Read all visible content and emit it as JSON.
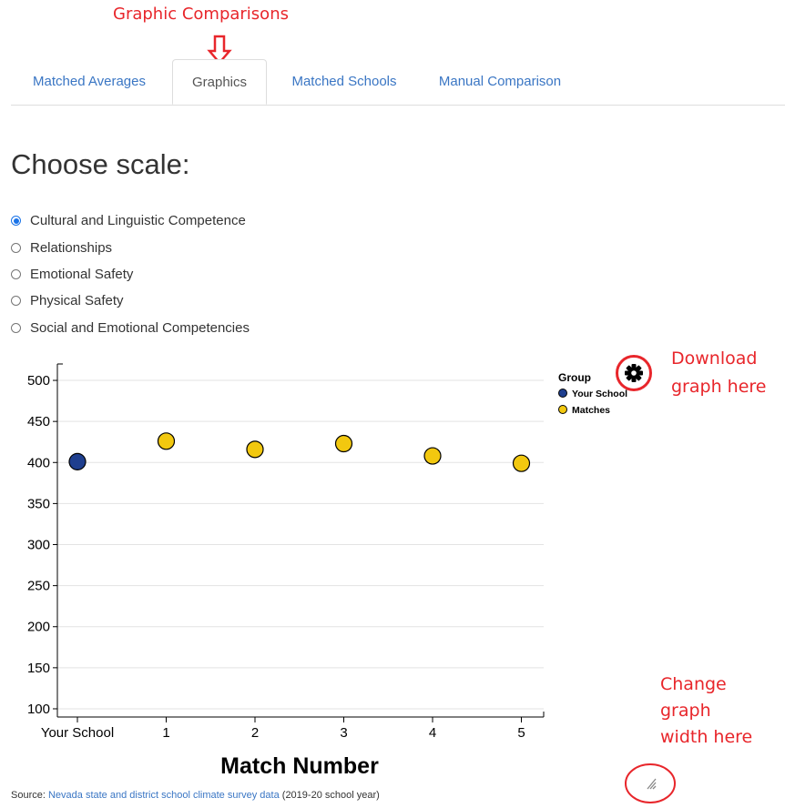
{
  "annotations": {
    "top": "Graphic Comparisons",
    "download": [
      "Download",
      "graph here"
    ],
    "width": [
      "Change",
      "graph",
      "width here"
    ]
  },
  "tabs": [
    {
      "label": "Matched Averages",
      "active": false
    },
    {
      "label": "Graphics",
      "active": true
    },
    {
      "label": "Matched Schools",
      "active": false
    },
    {
      "label": "Manual Comparison",
      "active": false
    }
  ],
  "scale_heading": "Choose scale:",
  "scales": [
    {
      "label": "Cultural and Linguistic Competence",
      "selected": true
    },
    {
      "label": "Relationships",
      "selected": false
    },
    {
      "label": "Emotional Safety",
      "selected": false
    },
    {
      "label": "Physical Safety",
      "selected": false
    },
    {
      "label": "Social and Emotional Competencies",
      "selected": false
    }
  ],
  "chart_data": {
    "type": "scatter",
    "xlabel": "Match Number",
    "ylabel": "",
    "categories": [
      "Your School",
      "1",
      "2",
      "3",
      "4",
      "5"
    ],
    "y_ticks": [
      100,
      150,
      200,
      250,
      300,
      350,
      400,
      450,
      500
    ],
    "ylim": [
      90,
      520
    ],
    "grid": true,
    "legend_title": "Group",
    "legend_position": "right",
    "series": [
      {
        "name": "Your School",
        "color": "#1f3f8f",
        "points": [
          {
            "x": "Your School",
            "y": 401
          }
        ]
      },
      {
        "name": "Matches",
        "color": "#f2c80f",
        "points": [
          {
            "x": "1",
            "y": 426
          },
          {
            "x": "2",
            "y": 416
          },
          {
            "x": "3",
            "y": 423
          },
          {
            "x": "4",
            "y": 408
          },
          {
            "x": "5",
            "y": 399
          }
        ]
      }
    ]
  },
  "icons": {
    "gear": "gear-icon",
    "resize": "resize-handle-icon",
    "arrow": "arrow-down-icon"
  },
  "colors": {
    "annotation": "#e8262b",
    "link": "#3a76c4",
    "radio_checked": "#1a73e8"
  },
  "source": {
    "prefix": "Source: ",
    "link_text": "Nevada state and district school climate survey data",
    "suffix": " (2019-20 school year)"
  }
}
